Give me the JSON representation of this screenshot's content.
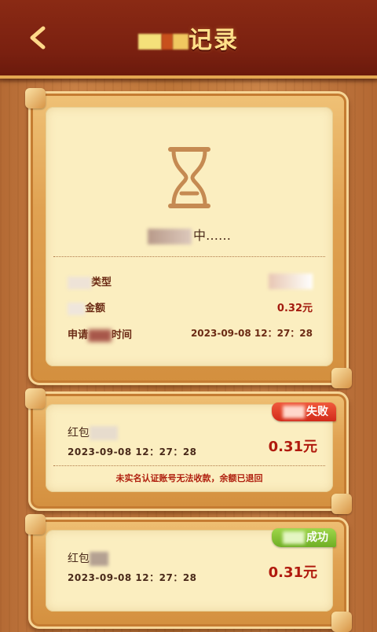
{
  "header": {
    "title_suffix": "记录"
  },
  "main_card": {
    "status_suffix": "中……",
    "rows": [
      {
        "label_suffix": "类型",
        "value": ""
      },
      {
        "label_suffix": "金额",
        "value": "0.32元"
      },
      {
        "label_prefix": "申请",
        "label_suffix": "时间",
        "value": "2023-09-08 12：27：28"
      }
    ]
  },
  "history": [
    {
      "title": "红包",
      "time": "2023-09-08 12：27：28",
      "amount": "0.31元",
      "status_suffix": "失败",
      "note": "未实名认证账号无法收款，余额已退回",
      "status_color": "#d92f1e"
    },
    {
      "title": "红包",
      "time": "2023-09-08 12：27：28",
      "amount": "0.31元",
      "status_suffix": "成功",
      "status_color": "#7bbb2c"
    }
  ],
  "colors": {
    "header_bg": "#7a2010",
    "title_gold": "#ffe08a",
    "paper": "#fbeec0",
    "amount_red": "#b01a0e"
  },
  "icons": {
    "back": "chevron-left-icon",
    "status": "hourglass-icon"
  }
}
